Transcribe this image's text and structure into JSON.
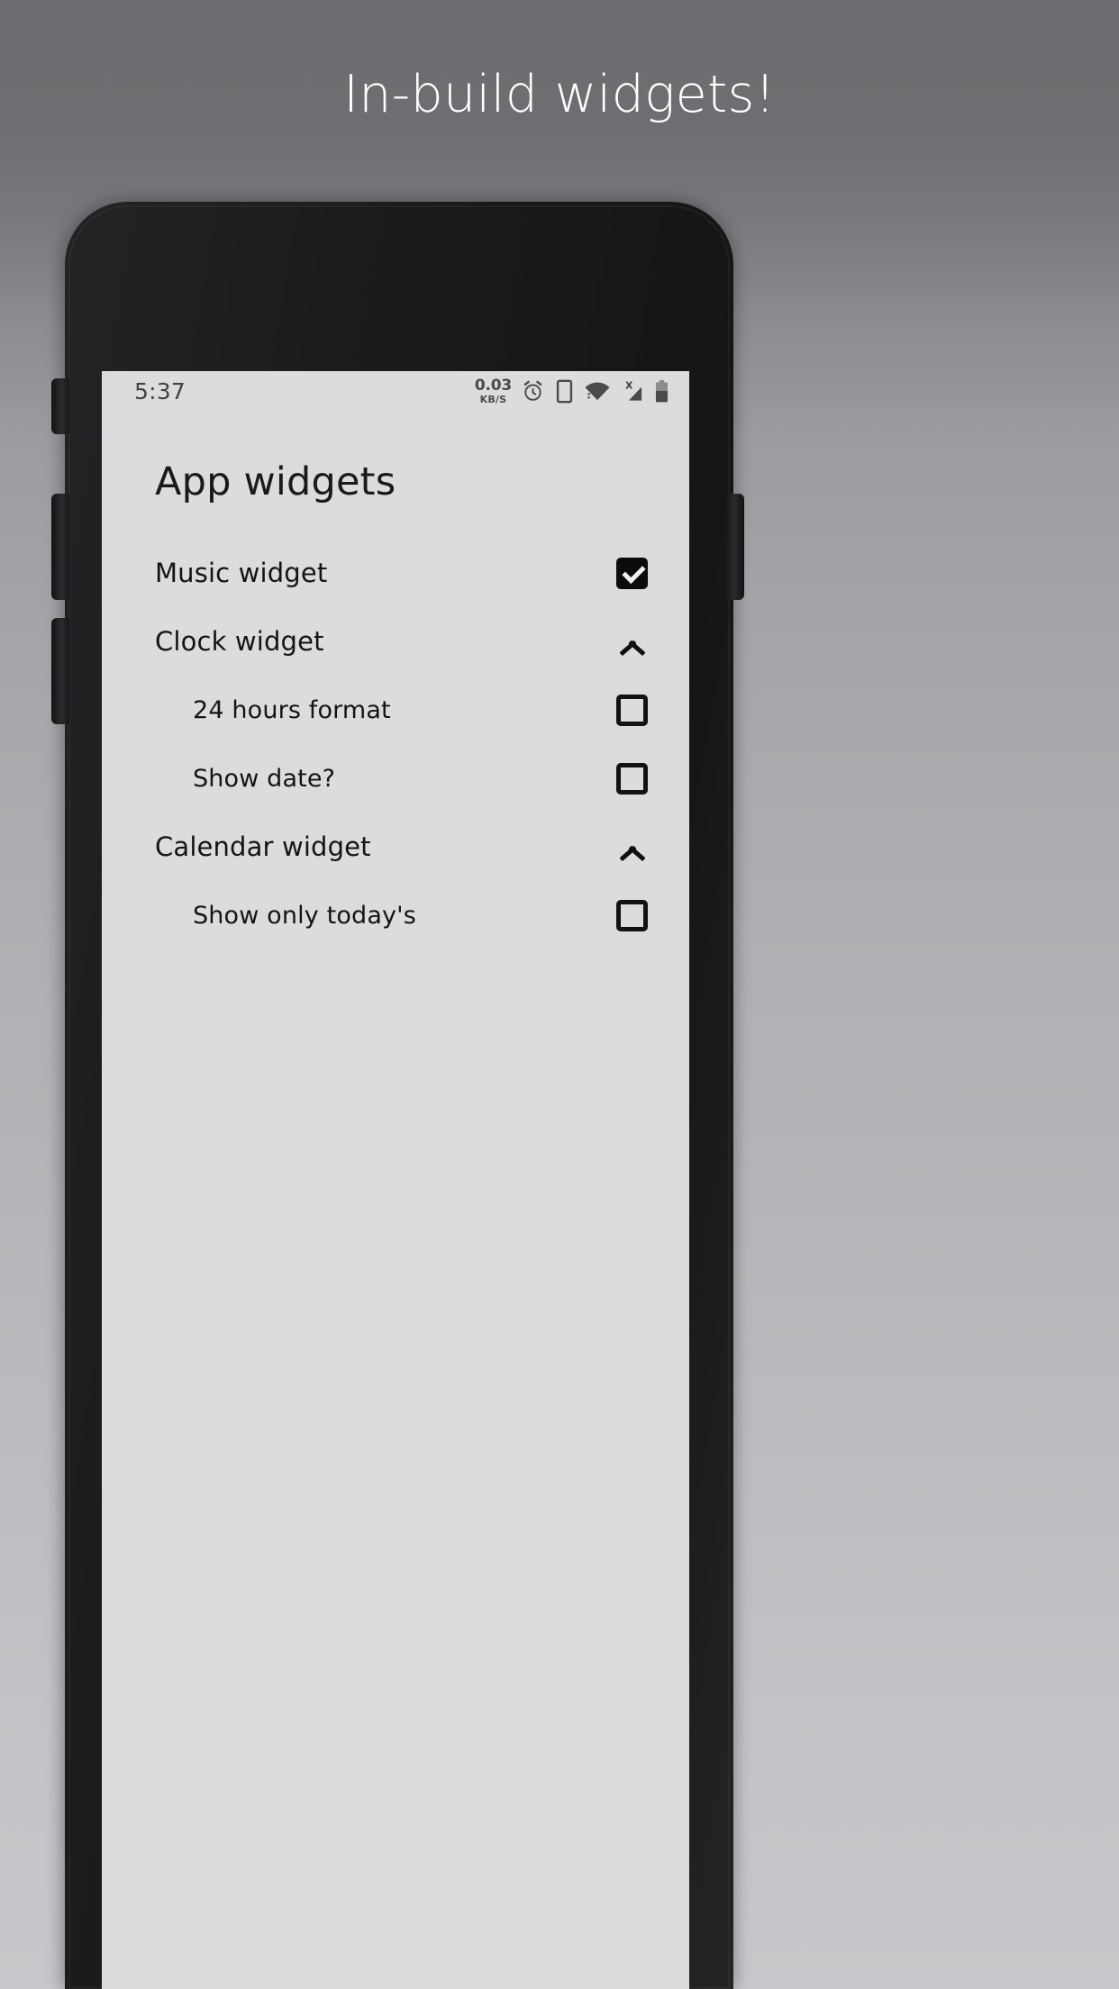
{
  "promo": {
    "headline": "In-build widgets!"
  },
  "statusbar": {
    "time": "5:37",
    "network_speed_value": "0.03",
    "network_speed_unit": "KB/S",
    "icons": [
      "alarm-icon",
      "device-icon",
      "wifi-icon",
      "signal-no-sim-icon",
      "battery-icon"
    ],
    "signal_badge": "X"
  },
  "screen": {
    "title": "App widgets",
    "background_color": "#dcdcdc",
    "text_color": "#141414"
  },
  "settings": {
    "rows": [
      {
        "label": "Music widget",
        "level": 0,
        "control": "checkbox",
        "checked": true
      },
      {
        "label": "Clock widget",
        "level": 0,
        "control": "chevron",
        "expanded": true
      },
      {
        "label": "24 hours format",
        "level": 1,
        "control": "checkbox",
        "checked": false
      },
      {
        "label": "Show date?",
        "level": 1,
        "control": "checkbox",
        "checked": false
      },
      {
        "label": "Calendar widget",
        "level": 0,
        "control": "chevron",
        "expanded": true
      },
      {
        "label": "Show only today's",
        "level": 1,
        "control": "checkbox",
        "checked": false
      }
    ]
  }
}
